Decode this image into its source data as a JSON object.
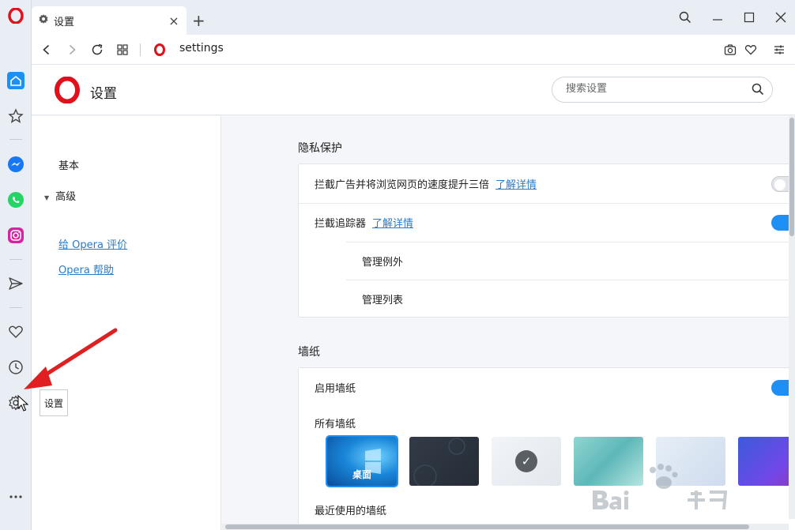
{
  "tab": {
    "title": "设置",
    "close": "×",
    "new_tab": "+"
  },
  "address": {
    "url": "settings"
  },
  "header": {
    "title": "设置",
    "search_placeholder": "搜索设置"
  },
  "left_nav": {
    "basic": "基本",
    "advanced": "高级",
    "advanced_arrow": "▼",
    "rate_opera": "给 Opera 评价",
    "opera_help": "Opera 帮助"
  },
  "privacy": {
    "title": "隐私保护",
    "block_ads": {
      "label": "拦截广告并将浏览网页的速度提升三倍",
      "link": "了解详情",
      "enabled": false
    },
    "block_trackers": {
      "label": "拦截追踪器",
      "link": "了解详情",
      "enabled": true
    },
    "manage_exceptions": "管理例外",
    "manage_lists": "管理列表"
  },
  "wallpaper": {
    "title": "墙纸",
    "enable": {
      "label": "启用墙纸",
      "enabled": true
    },
    "all_label": "所有墙纸",
    "recent_label": "最近使用的墙纸",
    "items": [
      {
        "label": "桌面",
        "selected": false
      },
      {
        "label": "",
        "selected": false
      },
      {
        "label": "",
        "selected": true,
        "check": "✓"
      },
      {
        "label": "",
        "selected": false
      },
      {
        "label": "",
        "selected": false
      },
      {
        "label": "",
        "selected": false
      }
    ]
  },
  "tooltip": {
    "text": "设置"
  },
  "colors": {
    "accent": "#1e90f5",
    "link": "#2a7bc9",
    "opera_red": "#e0101d",
    "arrow_red": "#e02020"
  }
}
